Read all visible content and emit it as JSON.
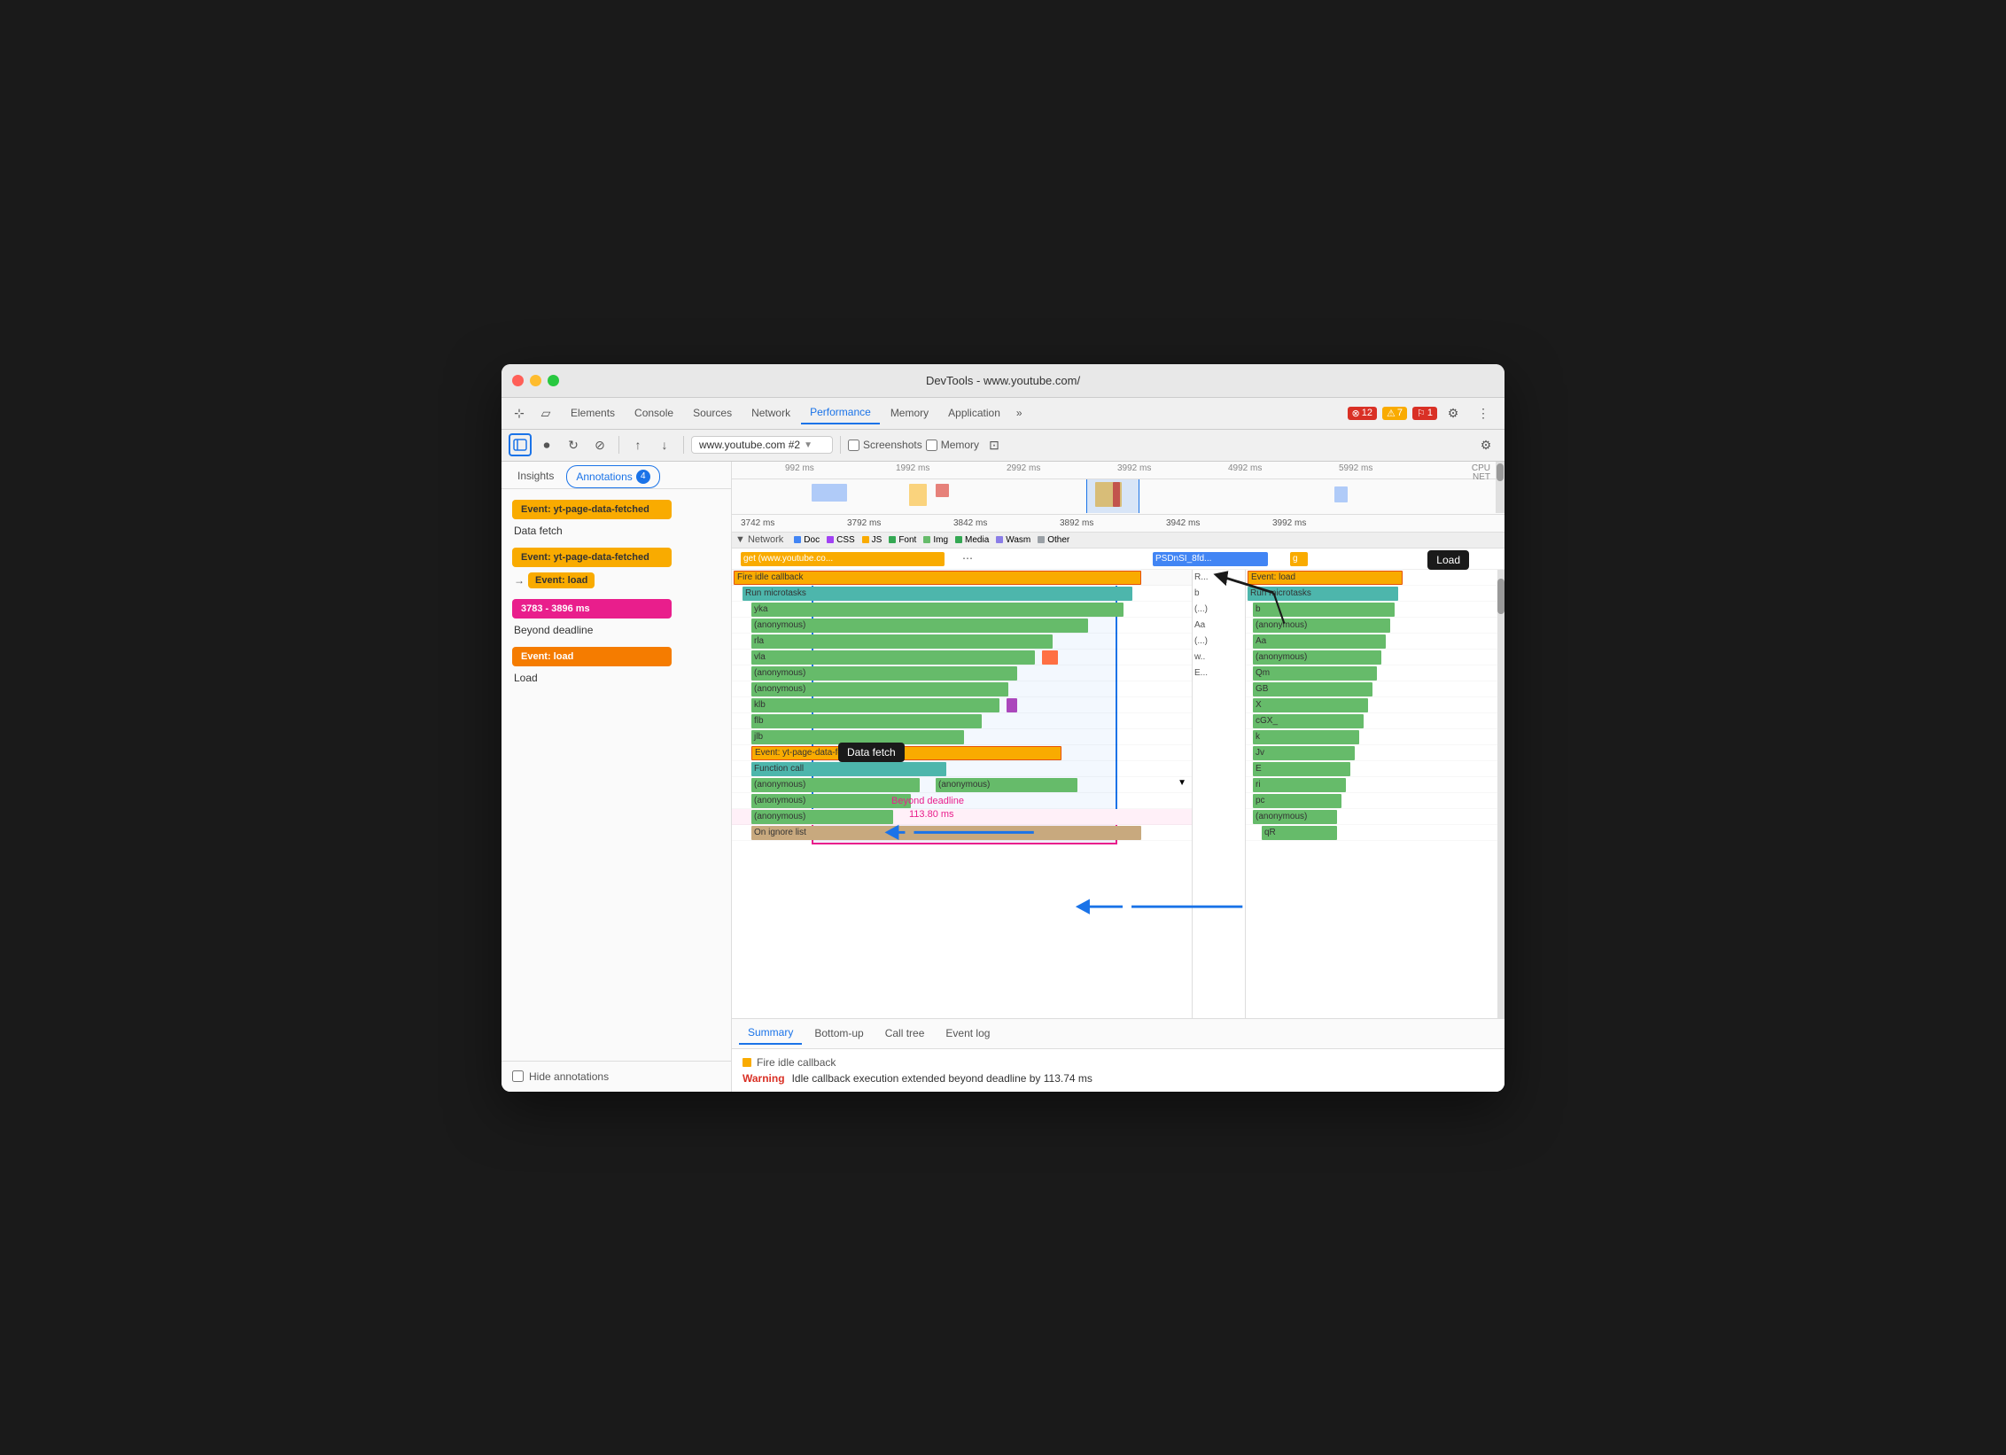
{
  "window": {
    "title": "DevTools - www.youtube.com/"
  },
  "traffic_lights": {
    "red": "close",
    "yellow": "minimize",
    "green": "maximize"
  },
  "tabs": {
    "items": [
      {
        "label": "Elements",
        "active": false
      },
      {
        "label": "Console",
        "active": false
      },
      {
        "label": "Sources",
        "active": false
      },
      {
        "label": "Network",
        "active": false
      },
      {
        "label": "Performance",
        "active": true
      },
      {
        "label": "Memory",
        "active": false
      },
      {
        "label": "Application",
        "active": false
      }
    ],
    "more": "»",
    "error_count": "12",
    "warn_count": "7",
    "info_count": "1"
  },
  "toolbar": {
    "record_icon": "⏺",
    "reload_icon": "↻",
    "clear_icon": "⊘",
    "upload_icon": "↑",
    "download_icon": "↓",
    "url": "www.youtube.com #2",
    "screenshots_label": "Screenshots",
    "memory_label": "Memory",
    "settings_icon": "⚙"
  },
  "sidebar": {
    "insights_label": "Insights",
    "annotations_label": "Annotations",
    "annotations_count": "4",
    "cards": [
      {
        "label": "Event: yt-page-data-fetched",
        "label_class": "label-yellow",
        "desc": "Data fetch",
        "has_link": false
      },
      {
        "label": "Event: yt-page-data-fetched",
        "label_class": "label-yellow",
        "desc": "",
        "has_link": true,
        "link_label": "Event: load",
        "link_class": "label-yellow"
      },
      {
        "label": "3783 - 3896 ms",
        "label_class": "label-pink",
        "desc": "Beyond deadline",
        "has_link": false
      },
      {
        "label": "Event: load",
        "label_class": "label-orange",
        "desc": "Load",
        "has_link": false
      }
    ],
    "hide_annotations": "Hide annotations"
  },
  "timeline": {
    "ruler_marks": [
      "992 ms",
      "1992 ms",
      "2992 ms",
      "3992 ms",
      "4992 ms",
      "5992 ms"
    ],
    "detail_marks": [
      "3742 ms",
      "3792 ms",
      "3842 ms",
      "3892 ms",
      "3942 ms",
      "3992 ms"
    ],
    "cpu_label": "CPU",
    "net_label": "NET"
  },
  "legend": {
    "items": [
      {
        "label": "Doc",
        "color": "#4285f4"
      },
      {
        "label": "CSS",
        "color": "#a142f4"
      },
      {
        "label": "JS",
        "color": "#f9ab00"
      },
      {
        "label": "Font",
        "color": "#34a853"
      },
      {
        "label": "Img",
        "color": "#66bb6a"
      },
      {
        "label": "Media",
        "color": "#34a853"
      },
      {
        "label": "Wasm",
        "color": "#8a7de7"
      },
      {
        "label": "Other",
        "color": "#9aa0a6"
      }
    ]
  },
  "network_requests": [
    {
      "label": "get (www.youtube.co...",
      "color": "#f9ab00"
    },
    {
      "label": "PSDnSI_8fd...",
      "color": "#4285f4"
    },
    {
      "label": "g",
      "color": "#f9ab00"
    }
  ],
  "annotations": {
    "data_fetch": "Data fetch",
    "beyond_deadline": "Beyond deadline",
    "load": "Load",
    "duration": "113.80 ms"
  },
  "flame_rows_left": [
    {
      "label": "Fire idle callback",
      "indent": 0,
      "type": "selected"
    },
    {
      "label": "Run microtasks",
      "indent": 1,
      "type": "teal"
    },
    {
      "label": "yka",
      "indent": 2,
      "type": "green"
    },
    {
      "label": "(anonymous)",
      "indent": 2,
      "type": "green"
    },
    {
      "label": "rla",
      "indent": 2,
      "type": "green"
    },
    {
      "label": "vla",
      "indent": 2,
      "type": "green"
    },
    {
      "label": "(anonymous)",
      "indent": 2,
      "type": "green"
    },
    {
      "label": "(anonymous)",
      "indent": 2,
      "type": "green"
    },
    {
      "label": "klb",
      "indent": 2,
      "type": "green"
    },
    {
      "label": "flb",
      "indent": 2,
      "type": "green"
    },
    {
      "label": "jlb",
      "indent": 2,
      "type": "green"
    },
    {
      "label": "Event: yt-page-data-fetched",
      "indent": 2,
      "type": "selected_yellow"
    },
    {
      "label": "Function call",
      "indent": 2,
      "type": "teal"
    },
    {
      "label": "(anonymous)",
      "indent": 2,
      "type": "green"
    },
    {
      "label": "(anonymous)",
      "indent": 2,
      "type": "green"
    },
    {
      "label": "(anonymous)",
      "indent": 2,
      "type": "green"
    },
    {
      "label": "On ignore list",
      "indent": 2,
      "type": "beige"
    }
  ],
  "flame_rows_right": [
    {
      "label": "R..."
    },
    {
      "label": "b"
    },
    {
      "label": "(...)"
    },
    {
      "label": "Aa"
    },
    {
      "label": "(...)"
    },
    {
      "label": "w.."
    },
    {
      "label": "E..."
    },
    {
      "label": ""
    },
    {
      "label": ""
    },
    {
      "label": ""
    },
    {
      "label": ""
    },
    {
      "label": ""
    },
    {
      "label": ""
    },
    {
      "label": "(anonymous)"
    },
    {
      "label": "(anonymous)"
    },
    {
      "label": "(anonymous)"
    },
    {
      "label": ""
    }
  ],
  "flame_rows_far_right": [
    {
      "label": "Event: load",
      "type": "selected_yellow"
    },
    {
      "label": "Run microtasks",
      "type": "teal"
    },
    {
      "label": "b",
      "type": "green"
    },
    {
      "label": "(anonymous)",
      "type": "green"
    },
    {
      "label": "Aa",
      "type": "green"
    },
    {
      "label": "(anonymous)",
      "type": "green"
    },
    {
      "label": "Qm",
      "type": "green"
    },
    {
      "label": "GB",
      "type": "green"
    },
    {
      "label": "X",
      "type": "green"
    },
    {
      "label": "cGX_",
      "type": "green"
    },
    {
      "label": "k",
      "type": "green"
    },
    {
      "label": "Jv",
      "type": "green"
    },
    {
      "label": "E",
      "type": "green"
    },
    {
      "label": "ri",
      "type": "green"
    },
    {
      "label": "pc",
      "type": "green"
    },
    {
      "label": "(anonymous)",
      "type": "green"
    },
    {
      "label": "qR",
      "type": "green"
    }
  ],
  "bottom_tabs": [
    {
      "label": "Summary",
      "active": true
    },
    {
      "label": "Bottom-up",
      "active": false
    },
    {
      "label": "Call tree",
      "active": false
    },
    {
      "label": "Event log",
      "active": false
    }
  ],
  "summary": {
    "title": "Fire idle callback",
    "warning_label": "Warning",
    "warning_text": "Idle callback execution extended beyond deadline by 113.74 ms"
  }
}
